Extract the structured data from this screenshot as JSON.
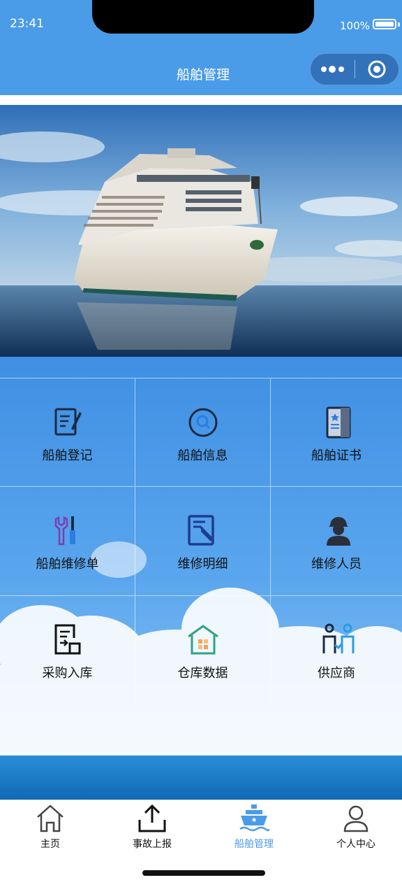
{
  "status": {
    "time": "23:41",
    "battery": "100%"
  },
  "header": {
    "title": "船舶管理"
  },
  "colors": {
    "header_bg": "#4a9ce9",
    "active_tab": "#4a9ce9",
    "dot_active": "#111111",
    "dot_inactive": "#1633d6"
  },
  "banner": {
    "image": "cruise-ship-at-sea",
    "slide_count": 4,
    "active_index": 0
  },
  "grid": {
    "items": [
      {
        "label": "船舶登记",
        "icon": "edit-document-icon"
      },
      {
        "label": "船舶信息",
        "icon": "search-icon"
      },
      {
        "label": "船舶证书",
        "icon": "certificate-icon"
      },
      {
        "label": "船舶维修单",
        "icon": "tools-icon"
      },
      {
        "label": "维修明细",
        "icon": "repair-list-icon"
      },
      {
        "label": "维修人员",
        "icon": "worker-icon"
      },
      {
        "label": "采购入库",
        "icon": "purchase-storage-icon"
      },
      {
        "label": "仓库数据",
        "icon": "warehouse-icon"
      },
      {
        "label": "供应商",
        "icon": "supplier-icon"
      }
    ]
  },
  "tabbar": {
    "items": [
      {
        "label": "主页",
        "icon": "home-icon",
        "active": false
      },
      {
        "label": "事故上报",
        "icon": "upload-icon",
        "active": false
      },
      {
        "label": "船舶管理",
        "icon": "ship-icon",
        "active": true
      },
      {
        "label": "个人中心",
        "icon": "user-icon",
        "active": false
      }
    ]
  }
}
